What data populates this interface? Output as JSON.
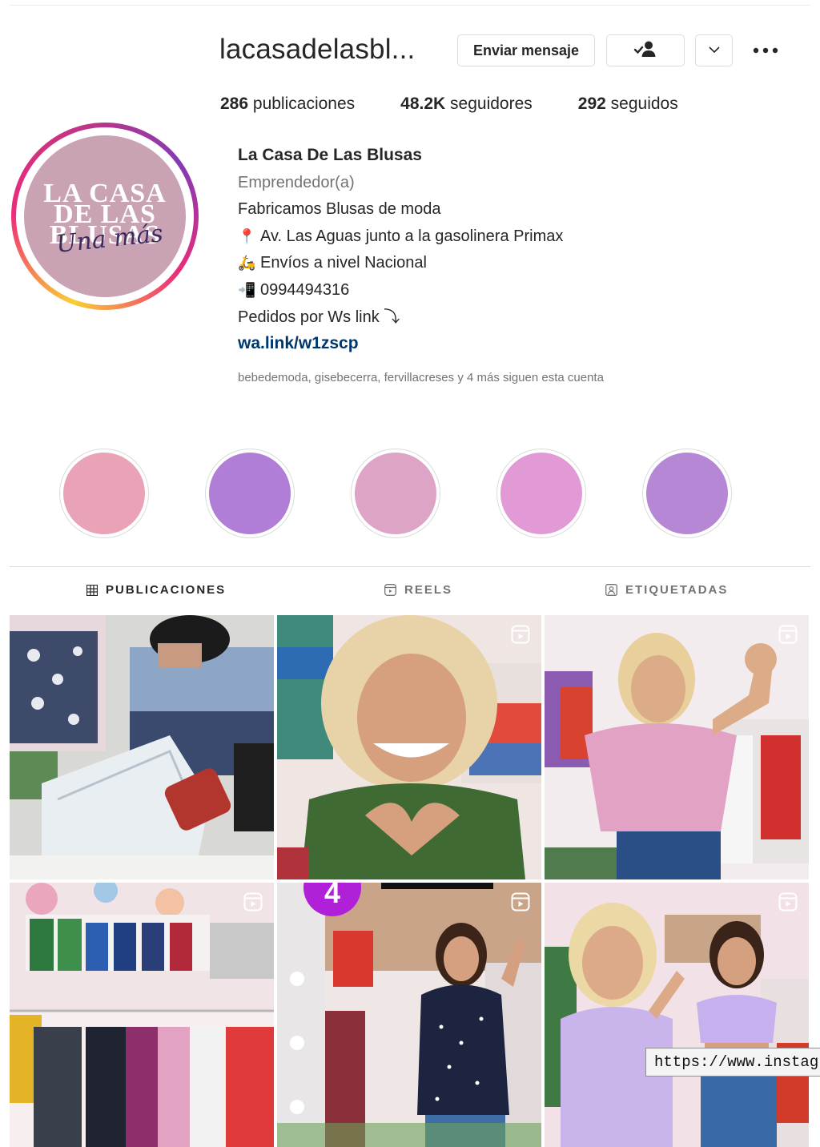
{
  "profile": {
    "username": "lacasadelasbl...",
    "message_button": "Enviar mensaje",
    "follow_icon": "person-check-icon",
    "dropdown_icon": "chevron-down-icon",
    "more_icon": "more-options-icon",
    "avatar_logo": {
      "line1": "LA CASA",
      "line2": "DE LAS",
      "line3": "BLUSAS",
      "script": "Una más"
    }
  },
  "stats": [
    {
      "value": "286",
      "label": "publicaciones"
    },
    {
      "value": "48.2K",
      "label": "seguidores"
    },
    {
      "value": "292",
      "label": "seguidos"
    }
  ],
  "bio": {
    "name": "La Casa De Las Blusas",
    "category": "Emprendedor(a)",
    "line1": "Fabricamos Blusas de moda",
    "address_icon": "📍",
    "address": "Av. Las Aguas junto a la gasolinera Primax",
    "delivery_icon": "🛵",
    "delivery": "Envíos a nivel Nacional",
    "phone_icon": "📲",
    "phone": "0994494316",
    "orders": "Pedidos por Ws link ⤵",
    "link": "wa.link/w1zscp"
  },
  "followed_by": "bebedemoda, gisebecerra, fervillacreses y 4 más siguen esta cuenta",
  "highlights": [
    {
      "color": "#eaa2b6"
    },
    {
      "color": "#b07ed6"
    },
    {
      "color": "#dda4c6"
    },
    {
      "color": "#e29ad6"
    },
    {
      "color": "#b587d4"
    }
  ],
  "tabs": [
    {
      "label": "PUBLICACIONES",
      "icon": "grid-icon",
      "active": true
    },
    {
      "label": "REELS",
      "icon": "reels-icon",
      "active": false
    },
    {
      "label": "ETIQUETADAS",
      "icon": "tagged-icon",
      "active": false
    }
  ],
  "grid_posts": [
    {
      "description": "delivery-packing-photo",
      "reel": false
    },
    {
      "description": "woman-heart-hands-green-shirt",
      "reel": true
    },
    {
      "description": "woman-pink-blouse-store",
      "reel": true
    },
    {
      "description": "store-clothing-racks",
      "reel": true
    },
    {
      "description": "woman-polka-dot-shirt",
      "reel": true,
      "badge": "4"
    },
    {
      "description": "two-women-lilac-tops",
      "reel": true
    }
  ],
  "tooltip": "https://www.instagram"
}
